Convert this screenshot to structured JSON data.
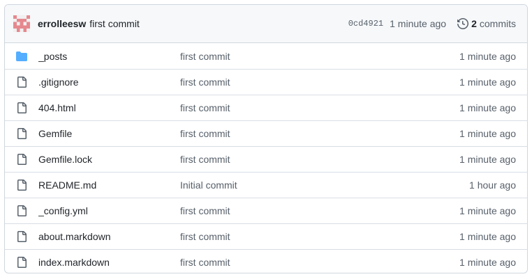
{
  "latest_commit": {
    "author": "errolleesw",
    "message": "first commit",
    "sha": "0cd4921",
    "time": "1 minute ago",
    "commits_count": "2",
    "commits_label": "commits",
    "avatar_icon": "identicon-avatar",
    "history_icon": "history-icon",
    "avatar_color": "#e5898f"
  },
  "files": [
    {
      "type": "folder",
      "icon": "folder-icon",
      "name": "_posts",
      "message": "first commit",
      "age": "1 minute ago"
    },
    {
      "type": "file",
      "icon": "file-icon",
      "name": ".gitignore",
      "message": "first commit",
      "age": "1 minute ago"
    },
    {
      "type": "file",
      "icon": "file-icon",
      "name": "404.html",
      "message": "first commit",
      "age": "1 minute ago"
    },
    {
      "type": "file",
      "icon": "file-icon",
      "name": "Gemfile",
      "message": "first commit",
      "age": "1 minute ago"
    },
    {
      "type": "file",
      "icon": "file-icon",
      "name": "Gemfile.lock",
      "message": "first commit",
      "age": "1 minute ago"
    },
    {
      "type": "file",
      "icon": "file-icon",
      "name": "README.md",
      "message": "Initial commit",
      "age": "1 hour ago"
    },
    {
      "type": "file",
      "icon": "file-icon",
      "name": "_config.yml",
      "message": "first commit",
      "age": "1 minute ago"
    },
    {
      "type": "file",
      "icon": "file-icon",
      "name": "about.markdown",
      "message": "first commit",
      "age": "1 minute ago"
    },
    {
      "type": "file",
      "icon": "file-icon",
      "name": "index.markdown",
      "message": "first commit",
      "age": "1 minute ago"
    }
  ],
  "colors": {
    "folder": "#54aeff",
    "file_icon": "#57606a",
    "border": "#d0d7de",
    "header_bg": "#f6f8fa"
  }
}
